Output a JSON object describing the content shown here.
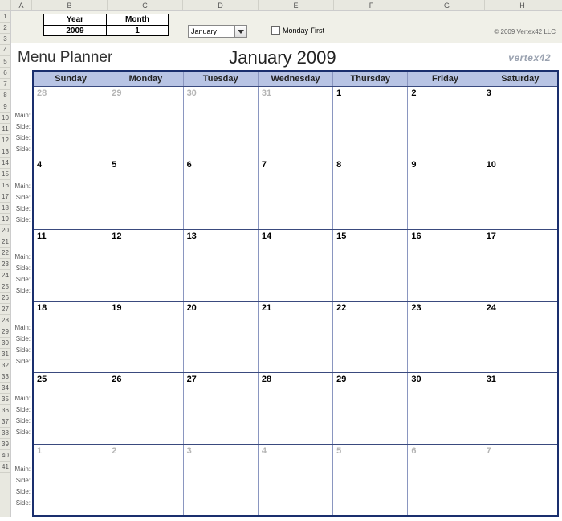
{
  "columns": [
    "A",
    "B",
    "C",
    "D",
    "E",
    "F",
    "G",
    "H"
  ],
  "controls": {
    "year_label": "Year",
    "month_label": "Month",
    "year_value": "2009",
    "month_value": "1",
    "dropdown_value": "January",
    "checkbox_label": "Monday First",
    "copyright": "© 2009 Vertex42 LLC"
  },
  "titles": {
    "planner": "Menu Planner",
    "calendar": "January 2009",
    "brand": "vertex42"
  },
  "weekdays": [
    "Sunday",
    "Monday",
    "Tuesday",
    "Wednesday",
    "Thursday",
    "Friday",
    "Saturday"
  ],
  "side_labels": [
    "Main:",
    "Side:",
    "Side:",
    "Side:"
  ],
  "weeks": [
    [
      {
        "n": "28",
        "dim": true
      },
      {
        "n": "29",
        "dim": true
      },
      {
        "n": "30",
        "dim": true
      },
      {
        "n": "31",
        "dim": true
      },
      {
        "n": "1"
      },
      {
        "n": "2"
      },
      {
        "n": "3"
      }
    ],
    [
      {
        "n": "4"
      },
      {
        "n": "5"
      },
      {
        "n": "6"
      },
      {
        "n": "7"
      },
      {
        "n": "8"
      },
      {
        "n": "9"
      },
      {
        "n": "10"
      }
    ],
    [
      {
        "n": "11"
      },
      {
        "n": "12"
      },
      {
        "n": "13"
      },
      {
        "n": "14"
      },
      {
        "n": "15"
      },
      {
        "n": "16"
      },
      {
        "n": "17"
      }
    ],
    [
      {
        "n": "18"
      },
      {
        "n": "19"
      },
      {
        "n": "20"
      },
      {
        "n": "21"
      },
      {
        "n": "22"
      },
      {
        "n": "23"
      },
      {
        "n": "24"
      }
    ],
    [
      {
        "n": "25"
      },
      {
        "n": "26"
      },
      {
        "n": "27"
      },
      {
        "n": "28"
      },
      {
        "n": "29"
      },
      {
        "n": "30"
      },
      {
        "n": "31"
      }
    ],
    [
      {
        "n": "1",
        "dim": true
      },
      {
        "n": "2",
        "dim": true
      },
      {
        "n": "3",
        "dim": true
      },
      {
        "n": "4",
        "dim": true
      },
      {
        "n": "5",
        "dim": true
      },
      {
        "n": "6",
        "dim": true
      },
      {
        "n": "7",
        "dim": true
      }
    ]
  ]
}
